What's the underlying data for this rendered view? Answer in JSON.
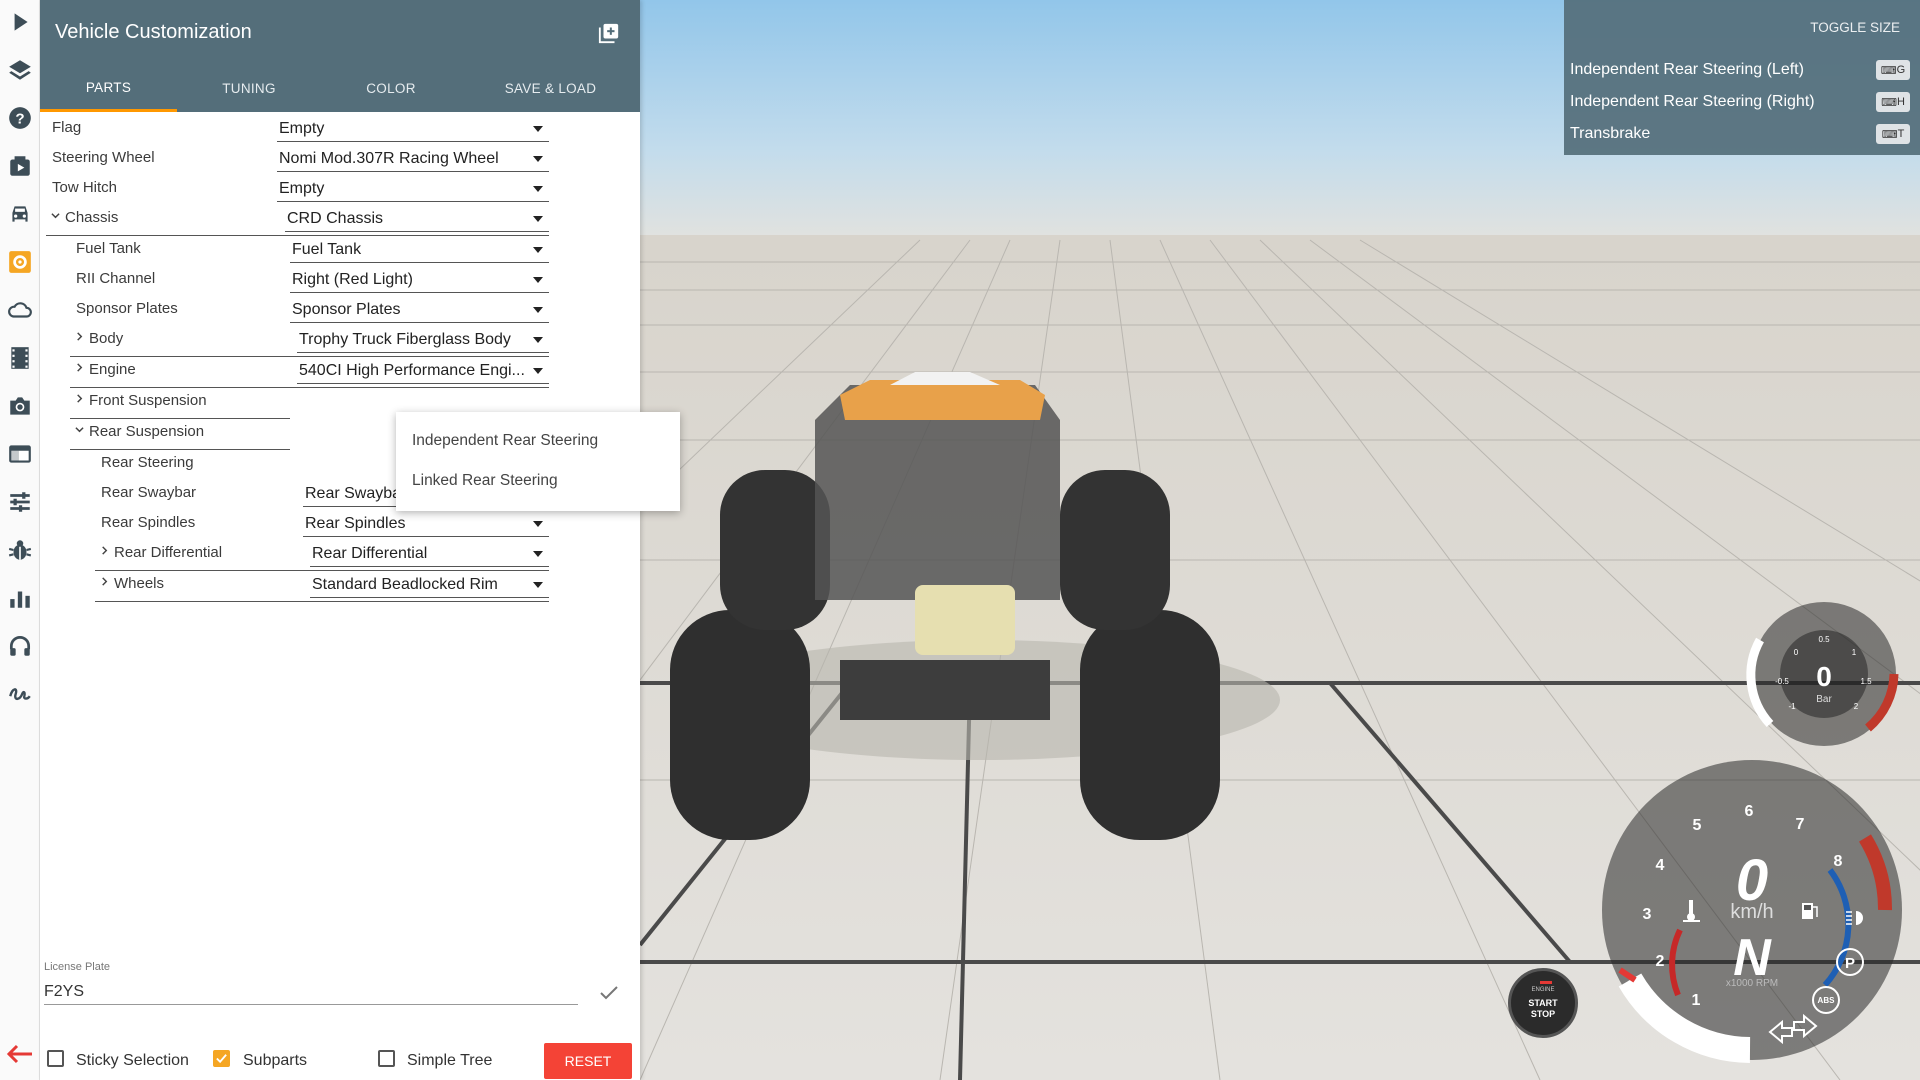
{
  "panel": {
    "title": "Vehicle Customization",
    "tabs": [
      {
        "label": "PARTS",
        "active": true
      },
      {
        "label": "TUNING",
        "active": false
      },
      {
        "label": "COLOR",
        "active": false
      },
      {
        "label": "SAVE & LOAD",
        "active": false
      }
    ]
  },
  "parts": [
    {
      "label": "Flag",
      "value": "Empty",
      "expander": "none"
    },
    {
      "label": "Steering Wheel",
      "value": "Nomi Mod.307R Racing Wheel",
      "expander": "none"
    },
    {
      "label": "Tow Hitch",
      "value": "Empty",
      "expander": "none"
    },
    {
      "label": "Chassis",
      "value": "CRD Chassis",
      "expander": "expanded"
    },
    {
      "label": "Fuel Tank",
      "value": "Fuel Tank",
      "expander": "none"
    },
    {
      "label": "RII Channel",
      "value": "Right (Red Light)",
      "expander": "none"
    },
    {
      "label": "Sponsor Plates",
      "value": "Sponsor Plates",
      "expander": "none"
    },
    {
      "label": "Body",
      "value": "Trophy Truck Fiberglass Body",
      "expander": "collapsed"
    },
    {
      "label": "Engine",
      "value": "540CI High Performance Engi...",
      "expander": "collapsed"
    },
    {
      "label": "Front Suspension",
      "value": "",
      "expander": "collapsed"
    },
    {
      "label": "Rear Suspension",
      "value": "",
      "expander": "expanded"
    },
    {
      "label": "Rear Steering",
      "value": "",
      "expander": "none"
    },
    {
      "label": "Rear Swaybar",
      "value": "Rear Swaybar",
      "expander": "none"
    },
    {
      "label": "Rear Spindles",
      "value": "Rear Spindles",
      "expander": "none"
    },
    {
      "label": "Rear Differential",
      "value": "Rear Differential",
      "expander": "collapsed"
    },
    {
      "label": "Wheels",
      "value": "Standard Beadlocked Rim",
      "expander": "collapsed"
    }
  ],
  "dropdown": {
    "options": [
      "Independent Rear Steering",
      "Linked Rear Steering"
    ]
  },
  "license_plate": {
    "label": "License Plate",
    "value": "F2YS"
  },
  "bottom": {
    "sticky_selection": {
      "label": "Sticky Selection",
      "checked": false
    },
    "subparts": {
      "label": "Subparts",
      "checked": true
    },
    "simple_tree": {
      "label": "Simple Tree",
      "checked": false
    },
    "reset_label": "RESET"
  },
  "controls": {
    "toggle_size": "TOGGLE SIZE",
    "items": [
      {
        "label": "Independent Rear Steering (Left)",
        "key": "G"
      },
      {
        "label": "Independent Rear Steering (Right)",
        "key": "H"
      },
      {
        "label": "Transbrake",
        "key": "T"
      }
    ]
  },
  "sidebar_icons": [
    "play-icon",
    "layers-icon",
    "help-icon",
    "media-icon",
    "car-icon",
    "vehicle-config-icon",
    "cloud-icon",
    "film-icon",
    "camera-icon",
    "window-icon",
    "sliders-icon",
    "bug-icon",
    "chart-icon",
    "headset-icon",
    "signature-icon"
  ],
  "hud": {
    "boost_value": "0",
    "boost_unit": "Bar",
    "boost_ticks": [
      "-1",
      "-0.5",
      "0",
      "0.5",
      "1",
      "1.5",
      "2"
    ],
    "speed_value": "0",
    "speed_unit": "km/h",
    "gear": "N",
    "rpm_unit": "x1000 RPM",
    "rpm_ticks": [
      "1",
      "2",
      "3",
      "4",
      "5",
      "6",
      "7",
      "8"
    ],
    "engine_label": "ENGINE",
    "start_label": "START",
    "stop_label": "STOP",
    "parking_label": "P",
    "abs_label": "ABS"
  },
  "colors": {
    "header": "#546e7a",
    "accent": "#ff9800",
    "reset": "#f44336",
    "active_icon": "#f5a623"
  }
}
